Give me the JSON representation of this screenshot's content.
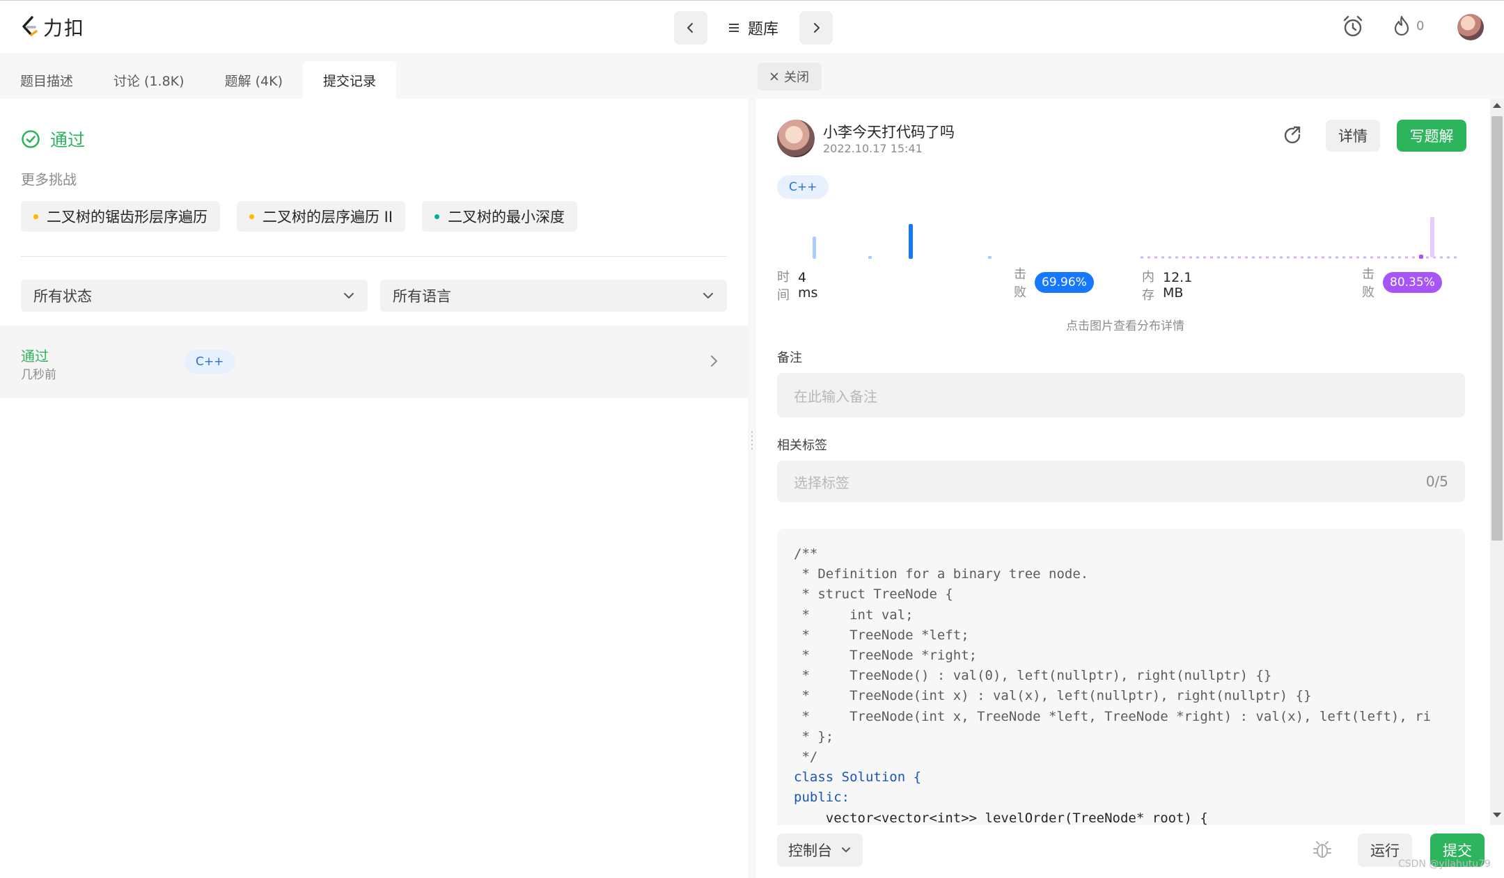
{
  "header": {
    "logo_text": "力扣",
    "nav_title": "题库",
    "fire_count": "0"
  },
  "left": {
    "tabs": [
      {
        "label": "题目描述"
      },
      {
        "label": "讨论 (1.8K)"
      },
      {
        "label": "题解 (4K)"
      },
      {
        "label": "提交记录"
      }
    ],
    "status_text": "通过",
    "more_label": "更多挑战",
    "challenges": [
      {
        "label": "二叉树的锯齿形层序遍历",
        "dot_color": "#ffb800"
      },
      {
        "label": "二叉树的层序遍历 II",
        "dot_color": "#ffb800"
      },
      {
        "label": "二叉树的最小深度",
        "dot_color": "#00af9b"
      }
    ],
    "status_filter": "所有状态",
    "language_filter": "所有语言",
    "submission": {
      "status": "通过",
      "time": "几秒前",
      "lang": "C++"
    }
  },
  "right": {
    "close_label": "关闭",
    "user_name": "小李今天打代码了吗",
    "date": "2022.10.17 15:41",
    "detail_label": "详情",
    "write_label": "写题解",
    "lang": "C++",
    "time_label": "时间",
    "time_value": "4 ms",
    "time_beat_label": "击败",
    "time_beat": "69.96%",
    "memory_label": "内存",
    "memory_value": "12.1 MB",
    "memory_beat_label": "击败",
    "memory_beat": "80.35%",
    "chart_caption": "点击图片查看分布详情",
    "note_label": "备注",
    "note_placeholder": "在此输入备注",
    "tags_label": "相关标签",
    "tags_placeholder": "选择标签",
    "tags_count": "0/5",
    "code_lines": [
      "/**",
      " * Definition for a binary tree node.",
      " * struct TreeNode {",
      " *     int val;",
      " *     TreeNode *left;",
      " *     TreeNode *right;",
      " *     TreeNode() : val(0), left(nullptr), right(nullptr) {}",
      " *     TreeNode(int x) : val(x), left(nullptr), right(nullptr) {}",
      " *     TreeNode(int x, TreeNode *left, TreeNode *right) : val(x), left(left), ri",
      " * };",
      " */",
      "class Solution {",
      "public:",
      "    vector<vector<int>> levelOrder(TreeNode* root) {"
    ]
  },
  "bottom": {
    "console_label": "控制台",
    "run_label": "运行",
    "submit_label": "提交"
  },
  "watermark": "CSDN @yilahutu79",
  "colors": {
    "accent_green": "#2db55d",
    "time_beat_color": "#1677ff",
    "memory_beat_color": "#a855f7"
  }
}
